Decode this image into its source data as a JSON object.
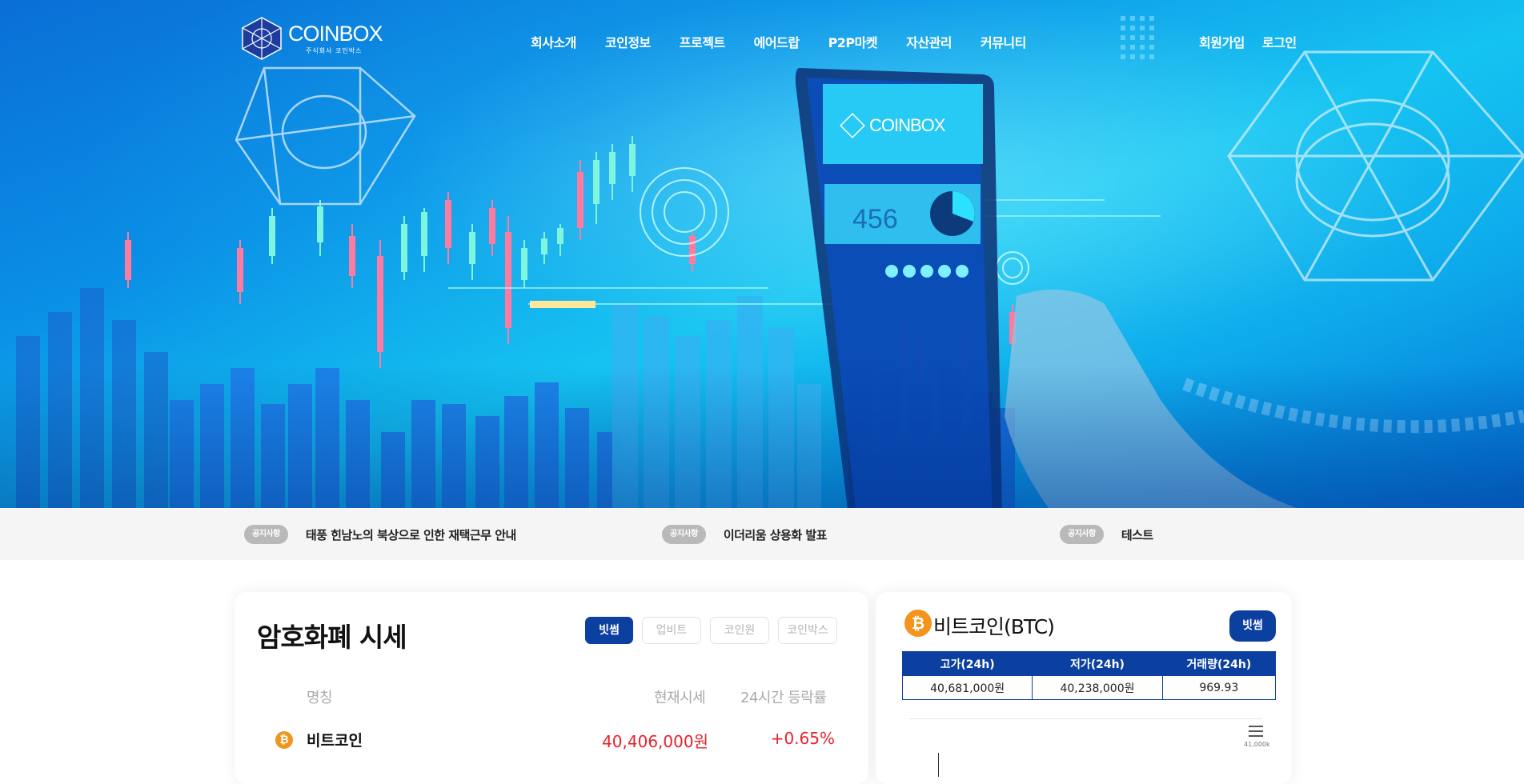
{
  "logo": {
    "name": "COINBOX",
    "subtitle": "주식회사 코인박스"
  },
  "nav": [
    "회사소개",
    "코인정보",
    "프로젝트",
    "에어드랍",
    "P2P마켓",
    "자산관리",
    "커뮤니티"
  ],
  "auth": [
    "회원가입",
    "로그인"
  ],
  "hero": {
    "screen_brand": "COINBOX",
    "screen_number": "456"
  },
  "notices": [
    {
      "badge": "공지사항",
      "text": "태풍 힌남노의 북상으로 인한 재택근무 안내"
    },
    {
      "badge": "공지사항",
      "text": "이더리움 상용화 발표"
    },
    {
      "badge": "공지사항",
      "text": "테스트"
    }
  ],
  "price_panel": {
    "title": "암호화폐 시세",
    "exchanges": [
      "빗썸",
      "업비트",
      "코인원",
      "코인박스"
    ],
    "active_exchange": "빗썸",
    "columns": {
      "name": "명칭",
      "price": "현재시세",
      "change": "24시간 등락률"
    },
    "rows": [
      {
        "icon": "bitcoin-icon",
        "symbol": "₿",
        "name": "비트코인",
        "price": "40,406,000원",
        "change": "+0.65%"
      }
    ]
  },
  "btc_panel": {
    "icon_symbol": "₿",
    "title": "비트코인(BTC)",
    "exchange": "빗썸",
    "headers": [
      "고가(24h)",
      "저가(24h)",
      "거래량(24h)"
    ],
    "values": [
      "40,681,000원",
      "40,238,000원",
      "969.93"
    ],
    "chart_tick": "41,000k"
  },
  "colors": {
    "brand_blue": "#0b3fa0",
    "price_up": "#e8222a",
    "coin_orange": "#f4941d"
  }
}
